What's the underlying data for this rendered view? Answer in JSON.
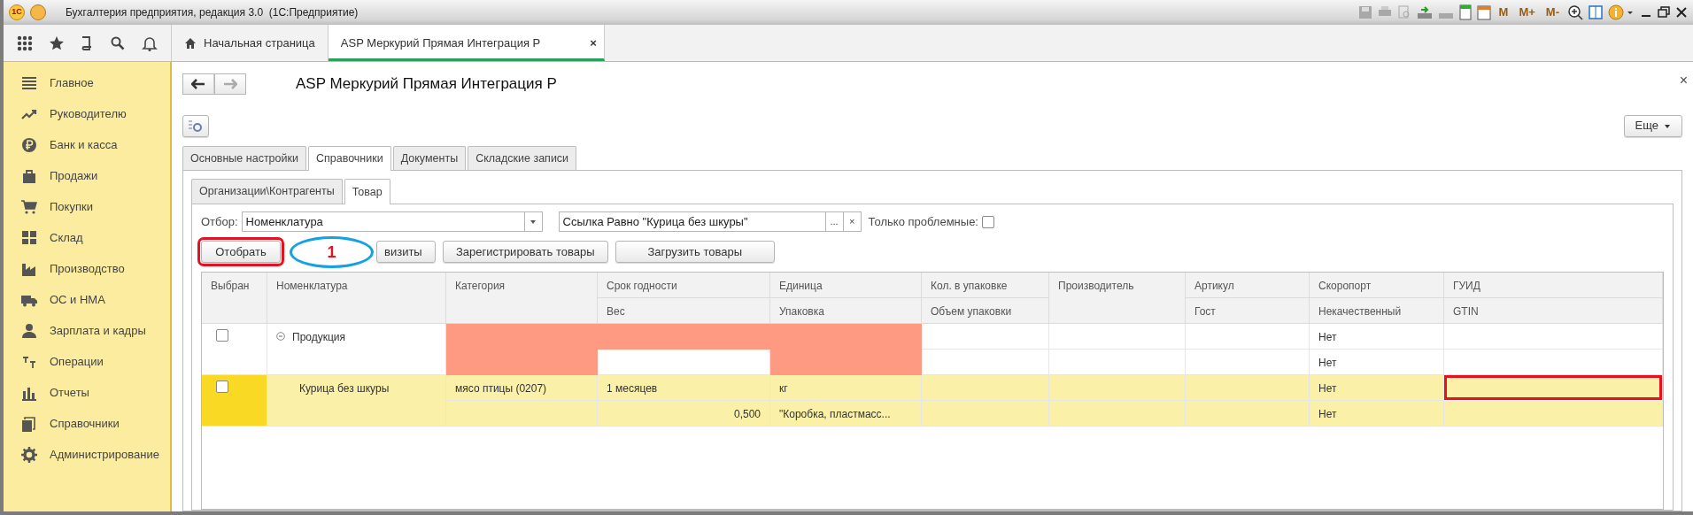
{
  "window": {
    "logo": "1С",
    "title": "Бухгалтерия предприятия, редакция 3.0  (1С:Предприятие)",
    "tools": [
      {
        "label": "M"
      },
      {
        "label": "M+"
      },
      {
        "label": "M-"
      }
    ]
  },
  "nav_tabs": [
    {
      "label": "Начальная страница",
      "selected": false
    },
    {
      "label": "ASP Меркурий Прямая Интеграция Р",
      "selected": true,
      "close": "×"
    }
  ],
  "sidebar": {
    "items": [
      {
        "label": "Главное"
      },
      {
        "label": "Руководителю"
      },
      {
        "label": "Банк и касса"
      },
      {
        "label": "Продажи"
      },
      {
        "label": "Покупки"
      },
      {
        "label": "Склад"
      },
      {
        "label": "Производство"
      },
      {
        "label": "ОС и НМА"
      },
      {
        "label": "Зарплата и кадры"
      },
      {
        "label": "Операции"
      },
      {
        "label": "Отчеты"
      },
      {
        "label": "Справочники"
      },
      {
        "label": "Администрирование"
      }
    ]
  },
  "form": {
    "title": "ASP Меркурий Прямая Интеграция Р",
    "close": "×",
    "more_button": "Еще",
    "tabs": [
      {
        "label": "Основные настройки",
        "selected": false
      },
      {
        "label": "Справочники",
        "selected": true
      },
      {
        "label": "Документы",
        "selected": false
      },
      {
        "label": "Складские записи",
        "selected": false
      }
    ],
    "subtabs": [
      {
        "label": "Организации\\Контрагенты",
        "selected": false
      },
      {
        "label": "Товар",
        "selected": true
      }
    ],
    "filter": {
      "label": "Отбор:",
      "field": "Номенклатура",
      "condition": "Ссылка Равно \"Курица без шкуры\"",
      "choose": "...",
      "clear": "×",
      "problems_label": "Только проблемные:",
      "problems_checked": false
    },
    "buttons": [
      {
        "label": "Отобрать",
        "highlighted": true
      },
      {
        "label": "визиты",
        "highlighted": false
      },
      {
        "label": "Зарегистрировать товары",
        "highlighted": false
      },
      {
        "label": "Загрузить товары",
        "highlighted": false
      }
    ],
    "callout": {
      "label": "1"
    },
    "table": {
      "columns": [
        {
          "header": "Выбран"
        },
        {
          "header": "Номенклатура"
        },
        {
          "header": "Категория"
        },
        {
          "header": "Срок годности",
          "subheader": "Вес"
        },
        {
          "header": "Единица",
          "subheader": "Упаковка"
        },
        {
          "header": "Кол. в упаковке",
          "subheader": "Объем упаковки"
        },
        {
          "header": "Производитель"
        },
        {
          "header": "Артикул",
          "subheader": "Гост"
        },
        {
          "header": "Скоропорт",
          "subheader": "Некачественный"
        },
        {
          "header": "ГУИД",
          "subheader": "GTIN"
        }
      ],
      "rows": [
        {
          "kind": "group",
          "selected": false,
          "cells": [
            {
              "checked": false
            },
            {
              "text": "Продукция",
              "expanded": true
            },
            {
              "top": {
                "problem": true
              },
              "bottom": {
                "problem": true
              }
            },
            {
              "top": {
                "problem": true
              },
              "bottom": {
                "problem": false
              }
            },
            {
              "top": {
                "problem": true
              },
              "bottom": {
                "problem": true
              }
            },
            null,
            null,
            null,
            {
              "top": {
                "text": "Нет"
              },
              "bottom": {
                "text": "Нет"
              }
            },
            null
          ]
        },
        {
          "kind": "item",
          "selected": true,
          "cells": [
            {
              "checked": false
            },
            {
              "text": "Курица без шкуры"
            },
            {
              "top": {
                "text": "мясо птицы (0207)"
              }
            },
            {
              "top": {
                "text": "1 месяцев"
              },
              "bottom": {
                "text": "0,500",
                "numeric": true
              }
            },
            {
              "top": {
                "text": "кг"
              },
              "bottom": {
                "text": "\"Коробка, пластмасс..."
              }
            },
            null,
            null,
            null,
            {
              "top": {
                "text": "Нет"
              },
              "bottom": {
                "text": "Нет"
              }
            },
            {
              "top": {
                "highlighted": true
              }
            }
          ]
        }
      ]
    }
  }
}
